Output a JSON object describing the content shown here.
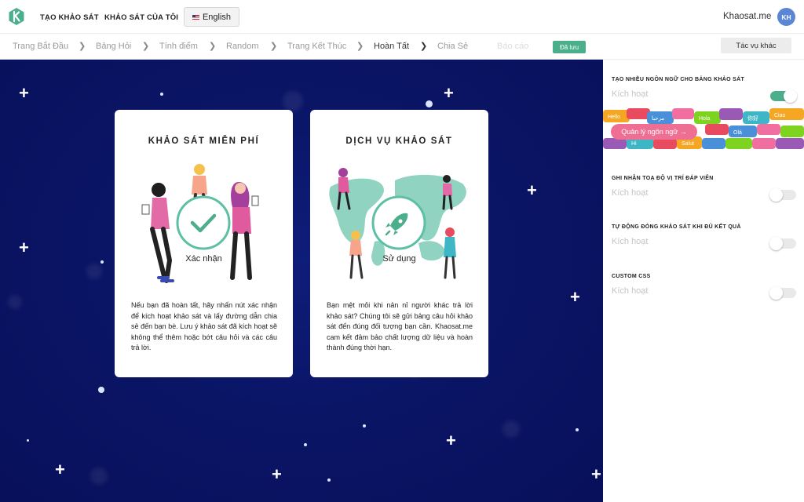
{
  "colors": {
    "accent": "#4caf8c",
    "canvas_bg": "#0a1566",
    "avatar_bg": "#5b86d6",
    "pink": "#ef6f92"
  },
  "topbar": {
    "logo_icon": "k-logo-icon",
    "nav": [
      "TẠO KHẢO SÁT",
      "KHẢO SÁT CỦA TÔI"
    ],
    "language": "English",
    "brand": "Khaosat.me",
    "avatar_initials": "KH"
  },
  "steps": [
    {
      "label": "Trang Bắt Đầu",
      "state": "done"
    },
    {
      "label": "Bảng Hỏi",
      "state": "done"
    },
    {
      "label": "Tính điểm",
      "state": "done"
    },
    {
      "label": "Random",
      "state": "done"
    },
    {
      "label": "Trang Kết Thúc",
      "state": "done"
    },
    {
      "label": "Hoàn Tất",
      "state": "active"
    },
    {
      "label": "Chia Sẻ",
      "state": "done"
    },
    {
      "label": "Báo cáo",
      "state": "disabled"
    }
  ],
  "toolbar": {
    "saved_badge": "Đã lưu",
    "more_actions": "Tác vụ khác"
  },
  "cards": [
    {
      "title": "KHẢO SÁT MIỄN PHÍ",
      "circle_label": "Xác nhận",
      "icon": "checkmark-icon",
      "description": "Nếu bạn đã hoàn tất, hãy nhấn nút xác nhận để kích hoạt khảo sát và lấy đường dẫn chia sẻ đến bạn bè. Lưu ý khảo sát đã kích hoạt sẽ không thể thêm hoặc bớt câu hỏi và các câu trả lời."
    },
    {
      "title": "DỊCH VỤ KHẢO SÁT",
      "circle_label": "Sử dụng",
      "icon": "rocket-icon",
      "description": "Bạn mệt mỏi khi nản nỉ người khác trả lời khảo sát? Chúng tôi sẽ gửi bảng câu hỏi khảo sát đến đúng đối tượng bạn cần. Khaosat.me cam kết đảm bảo chất lượng dữ liệu và hoàn thành đúng thời hạn."
    }
  ],
  "settings": [
    {
      "title": "TẠO NHIỀU NGÔN NGỮ CHO BẢNG KHẢO SÁT",
      "status": "Kích hoạt",
      "enabled": true,
      "banner_button": "Quản lý ngôn ngữ →"
    },
    {
      "title": "GHI NHẬN TOẠ ĐỘ VỊ TRÍ ĐÁP VIÊN",
      "status": "Kích hoạt",
      "enabled": false
    },
    {
      "title": "TỰ ĐỘNG ĐÓNG KHẢO SÁT KHI ĐỦ KẾT QUẢ",
      "status": "Kích hoạt",
      "enabled": false
    },
    {
      "title": "CUSTOM CSS",
      "status": "Kích hoạt",
      "enabled": false
    }
  ],
  "banner_words": [
    "Hello",
    "مرحبا",
    "Hola",
    "你好",
    "Ciao",
    "Olá",
    "Hi",
    "Salut"
  ]
}
